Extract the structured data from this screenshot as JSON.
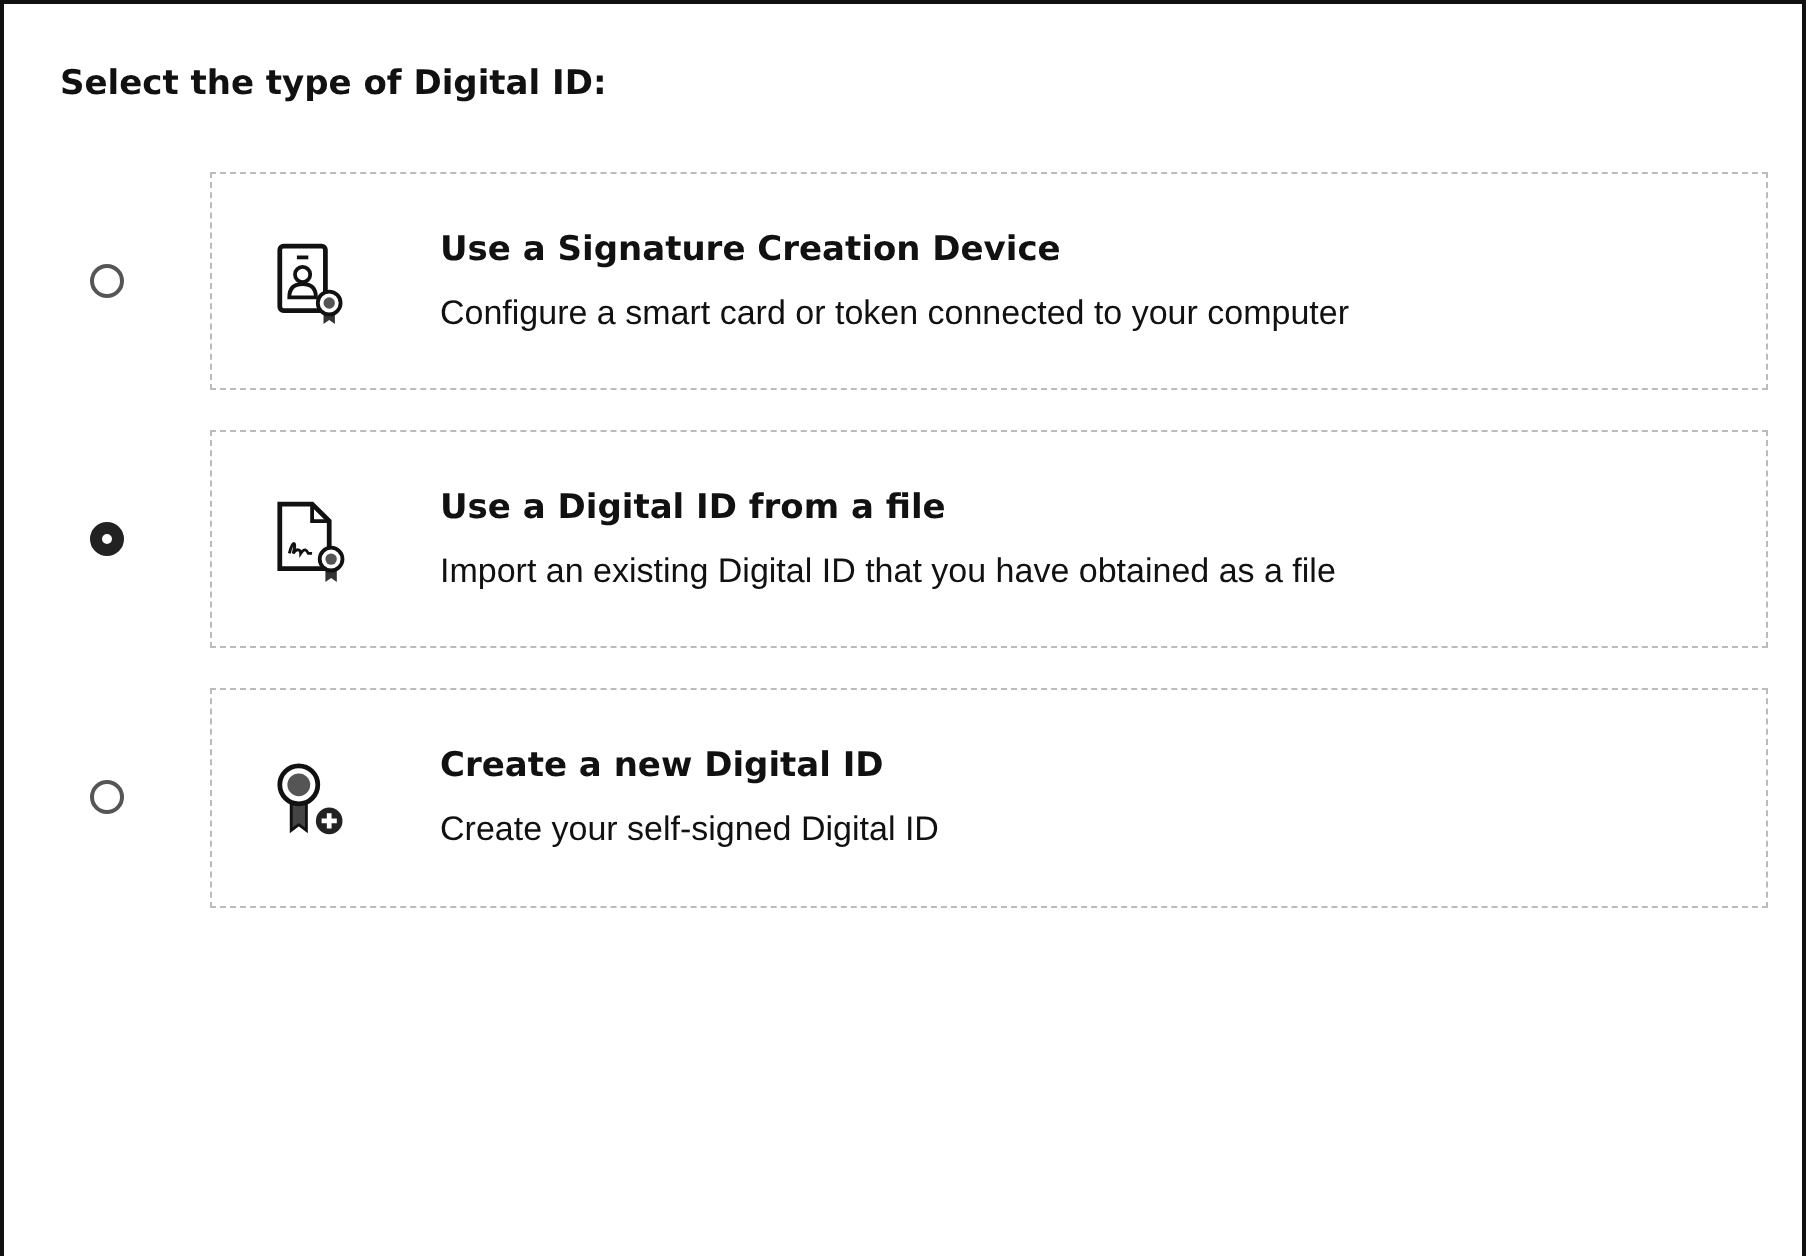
{
  "heading": "Select the type of Digital ID:",
  "options": [
    {
      "kind": "device",
      "title": "Use a Signature Creation Device",
      "description": "Configure a smart card or token connected to your computer",
      "selected": false
    },
    {
      "kind": "file",
      "title": "Use a Digital ID from a file",
      "description": "Import an existing Digital ID that you have obtained as a file",
      "selected": true
    },
    {
      "kind": "new",
      "title": "Create a new Digital ID",
      "description": "Create your self-signed Digital ID",
      "selected": false
    }
  ]
}
